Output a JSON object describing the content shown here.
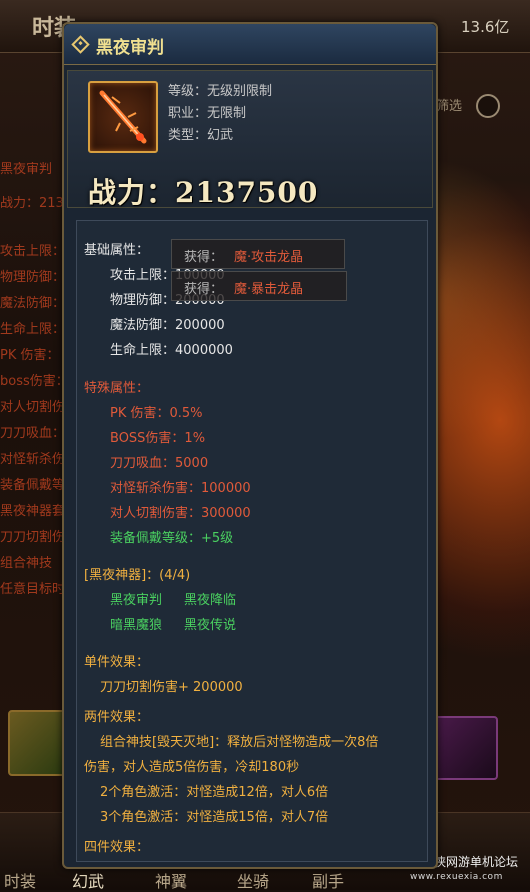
{
  "background": {
    "title": "时装",
    "gold": "13.6亿",
    "filter_label": "筛选",
    "left_texts": [
      "黑夜审判",
      "战力：213",
      "攻击上限：",
      "物理防御：",
      "魔法防御：",
      "生命上限：",
      "PK 伤害：",
      "boss伤害：",
      "对人切割伤",
      "刀刀吸血：",
      "对怪斩杀伤",
      "装备佩戴等",
      "黑夜神器套",
      "刀刀切割伤",
      "组合神技",
      "任意目标时"
    ],
    "tabs": [
      "时装",
      "幻武",
      "神翼",
      "坐骑",
      "副手"
    ],
    "watermark": "热血侠网游单机论坛",
    "watermark_url": "www.rexuexia.com"
  },
  "tooltip": {
    "title": "黑夜审判",
    "level": "等级：无级别限制",
    "profession": "职业：无限制",
    "type": "类型：幻武",
    "power": "战力：2137500",
    "base_header": "基础属性：",
    "base_attrs": [
      "攻击上限：100000",
      "物理防御：200000",
      "魔法防御：200000",
      "生命上限：4000000"
    ],
    "obtain_rows": [
      {
        "label": "获得：",
        "value": "魔·攻击龙晶"
      },
      {
        "label": "获得：",
        "value": "魔·暴击龙晶"
      }
    ],
    "special_header": "特殊属性：",
    "special_attrs": [
      "PK 伤害：0.5%",
      "BOSS伤害：1%",
      "刀刀吸血：5000",
      "对怪斩杀伤害：100000",
      "对人切割伤害：300000"
    ],
    "equip_level": "装备佩戴等级：+5级",
    "set_header": "[黑夜神器]：(4/4)",
    "set_items": [
      "黑夜审判",
      "黑夜降临",
      "暗黑魔狼",
      "黑夜传说"
    ],
    "single_header": "单件效果：",
    "single_effect": "刀刀切割伤害+ 200000",
    "two_header": "两件效果：",
    "two_effect_line1": "组合神技[毁天灭地]：释放后对怪物造成一次8倍",
    "two_effect_line2": "伤害，对人造成5倍伤害，冷却180秒",
    "two_effect_line3": "2个角色激活：对怪造成12倍，对人6倍",
    "two_effect_line4": "3个角色激活：对怪造成15倍，对人7倍",
    "four_header": "四件效果："
  }
}
